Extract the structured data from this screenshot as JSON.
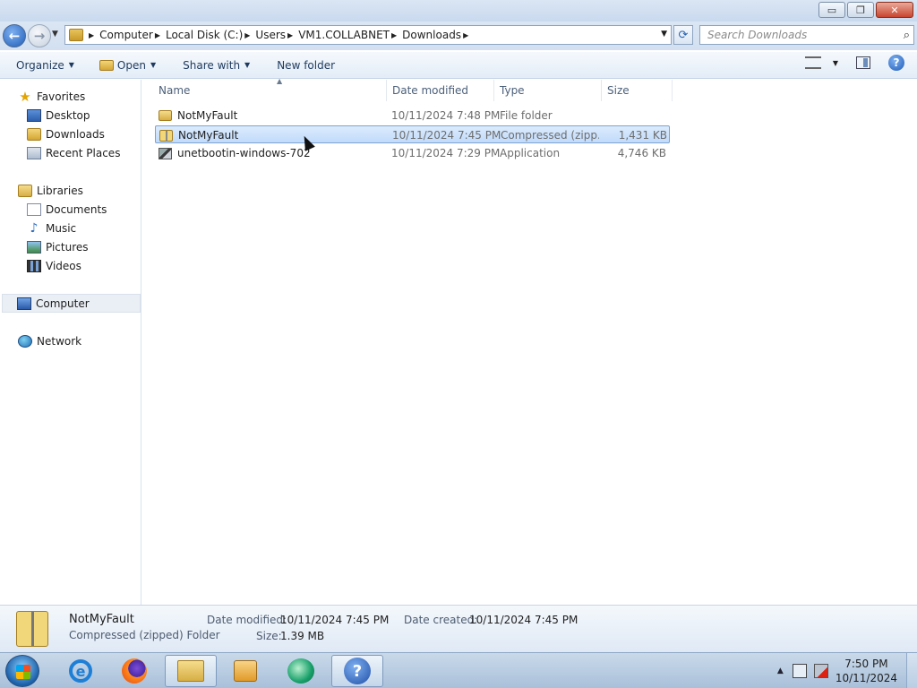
{
  "window": {
    "controls": {
      "minimize": "▭",
      "maximize": "❐",
      "close": "✕"
    }
  },
  "address": {
    "crumbs": [
      "Computer",
      "Local Disk (C:)",
      "Users",
      "VM1.COLLABNET",
      "Downloads"
    ]
  },
  "search": {
    "placeholder": "Search Downloads"
  },
  "toolbar": {
    "organize_label": "Organize",
    "open_label": "Open",
    "share_label": "Share with",
    "new_folder_label": "New folder"
  },
  "nav": {
    "favorites_label": "Favorites",
    "desktop_label": "Desktop",
    "downloads_label": "Downloads",
    "recent_label": "Recent Places",
    "libraries_label": "Libraries",
    "documents_label": "Documents",
    "music_label": "Music",
    "pictures_label": "Pictures",
    "videos_label": "Videos",
    "computer_label": "Computer",
    "network_label": "Network"
  },
  "columns": {
    "name": "Name",
    "date": "Date modified",
    "type": "Type",
    "size": "Size"
  },
  "files": [
    {
      "name": "NotMyFault",
      "date": "10/11/2024 7:48 PM",
      "type": "File folder",
      "size": "",
      "icon": "folder-icon"
    },
    {
      "name": "NotMyFault",
      "date": "10/11/2024 7:45 PM",
      "type": "Compressed (zipp...",
      "size": "1,431 KB",
      "icon": "zip-folder-icon",
      "selected": true
    },
    {
      "name": "unetbootin-windows-702",
      "date": "10/11/2024 7:29 PM",
      "type": "Application",
      "size": "4,746 KB",
      "icon": "application-icon"
    }
  ],
  "details": {
    "name": "NotMyFault",
    "kind": "Compressed (zipped) Folder",
    "date_modified_label": "Date modified:",
    "date_modified": "10/11/2024 7:45 PM",
    "date_created_label": "Date created:",
    "date_created": "10/11/2024 7:45 PM",
    "size_label": "Size:",
    "size": "1.39 MB"
  },
  "taskbar": {
    "time": "7:50 PM",
    "date": "10/11/2024"
  },
  "colors": {
    "selection": "#cce4fc",
    "accent": "#1f5db8"
  }
}
